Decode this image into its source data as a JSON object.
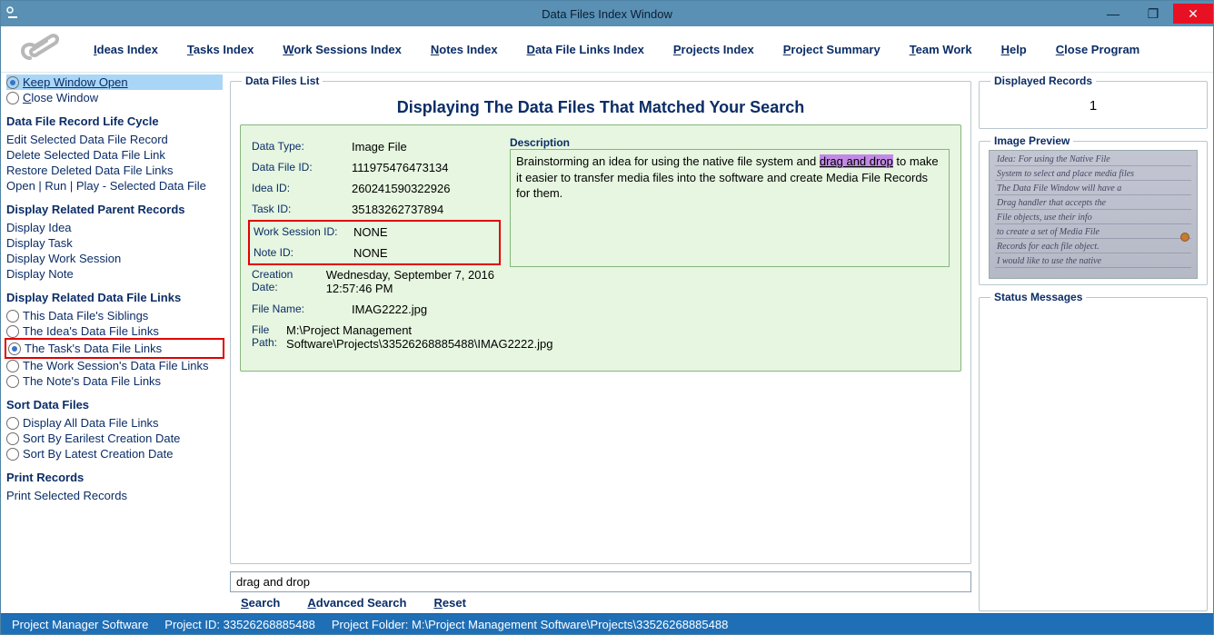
{
  "window": {
    "title": "Data Files Index Window"
  },
  "menu": {
    "ideas": "Ideas Index",
    "tasks": "Tasks Index",
    "work": "Work Sessions Index",
    "notes": "Notes Index",
    "dflinks": "Data File Links Index",
    "projects": "Projects Index",
    "projsum": "Project Summary",
    "team": "Team Work",
    "help": "Help",
    "close": "Close Program"
  },
  "sidebar": {
    "keep_open": "Keep Window Open",
    "close_window": "Close Window",
    "lifecycle_title": "Data File Record Life Cycle",
    "lifecycle": {
      "edit": "Edit Selected Data File Record",
      "delete": "Delete Selected Data File Link",
      "restore": "Restore Deleted Data File Links",
      "open": "Open | Run | Play - Selected Data File"
    },
    "related_parent_title": "Display Related Parent Records",
    "related_parent": {
      "idea": "Display Idea",
      "task": "Display Task",
      "work": "Display Work Session",
      "note": "Display Note"
    },
    "related_links_title": "Display Related Data File Links",
    "related_links": {
      "siblings": "This Data File's Siblings",
      "idea": "The Idea's Data File Links",
      "task": "The Task's Data File Links",
      "work": "The Work Session's Data File Links",
      "note": "The Note's Data File Links"
    },
    "sort_title": "Sort Data Files",
    "sort": {
      "all": "Display All Data File Links",
      "earliest": "Sort By Earilest Creation Date",
      "latest": "Sort By Latest Creation Date"
    },
    "print_title": "Print Records",
    "print_selected": "Print Selected Records"
  },
  "dataFilesList": {
    "legend": "Data Files List",
    "title": "Displaying The Data Files That Matched Your Search",
    "labels": {
      "data_type": "Data Type:",
      "data_file_id": "Data File ID:",
      "idea_id": "Idea ID:",
      "task_id": "Task ID:",
      "work_id": "Work Session ID:",
      "note_id": "Note ID:",
      "creation_date": "Creation Date:",
      "file_name": "File Name:",
      "file_path": "File Path:",
      "description": "Description"
    },
    "record": {
      "data_type": "Image File",
      "data_file_id": "111975476473134",
      "idea_id": "260241590322926",
      "task_id": "35183262737894",
      "work_id": "NONE",
      "note_id": "NONE",
      "creation_date": "Wednesday, September 7, 2016   12:57:46 PM",
      "file_name": "IMAG2222.jpg",
      "file_path": "M:\\Project Management Software\\Projects\\33526268885488\\IMAG2222.jpg",
      "description_pre": "Brainstorming an idea for using the native file system and ",
      "description_hl": "drag and drop",
      "description_post": " to make it easier to transfer media files into the software and create Media File Records for them."
    }
  },
  "search": {
    "value": "drag and drop",
    "search": "Search",
    "advanced": "Advanced Search",
    "reset": "Reset"
  },
  "right": {
    "displayed_legend": "Displayed Records",
    "displayed_value": "1",
    "preview_legend": "Image Preview",
    "status_legend": "Status Messages",
    "preview_lines": [
      "Idea: For using the Native File",
      "System to select and place media files",
      "The Data File Window will have a",
      "Drag handler that accepts the",
      "File objects, use their info",
      "to create a set of Media File",
      "Records for each file object.",
      "I would like to use the native"
    ]
  },
  "statusbar": {
    "app": "Project Manager Software",
    "project_id_label": "Project ID:",
    "project_id": "33526268885488",
    "project_folder_label": "Project Folder:",
    "project_folder": "M:\\Project Management Software\\Projects\\33526268885488"
  }
}
